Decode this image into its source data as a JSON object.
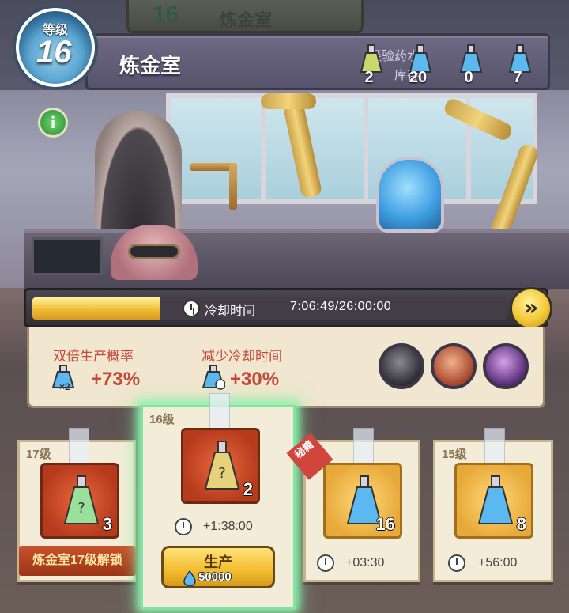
{
  "top_strip": {
    "level": "16",
    "name": "炼金室"
  },
  "level_badge": {
    "label": "等级",
    "value": "16"
  },
  "banner": {
    "title": "炼金室",
    "inventory_label_1": "经验药水",
    "inventory_label_2": "库存",
    "inventory": [
      {
        "count": "2",
        "color": "#c8d86a"
      },
      {
        "count": "20",
        "color": "#5bb8f0"
      },
      {
        "count": "0",
        "color": "#5bb8f0"
      },
      {
        "count": "7",
        "color": "#5bb8f0"
      }
    ]
  },
  "cooldown": {
    "label": "冷却时间",
    "time": "7:06:49/26:00:00",
    "progress": 0.27,
    "skip_icon": "»"
  },
  "bonus": {
    "double_label": "双倍生产概率",
    "double_value": "+73%",
    "multiplier": "×2",
    "reduce_label": "减少冷却时间",
    "reduce_value": "+30%"
  },
  "heroes": [
    "hero-1",
    "hero-2",
    "hero-3"
  ],
  "cards": [
    {
      "level": "17级",
      "qty": "3",
      "locked_text": "炼金室17级解锁"
    },
    {
      "level": "16级",
      "qty": "2",
      "time": "+1:38:00",
      "button_label": "生产",
      "cost": "50000"
    },
    {
      "level": "",
      "qty": "16",
      "time": "+03:30",
      "stamp": "秘籍"
    },
    {
      "level": "15级",
      "qty": "8",
      "time": "+56:00"
    }
  ],
  "colors": {
    "accent_gold": "#f2c23c",
    "warning_red": "#c44a3a",
    "selected_glow": "#8ff0b0"
  }
}
